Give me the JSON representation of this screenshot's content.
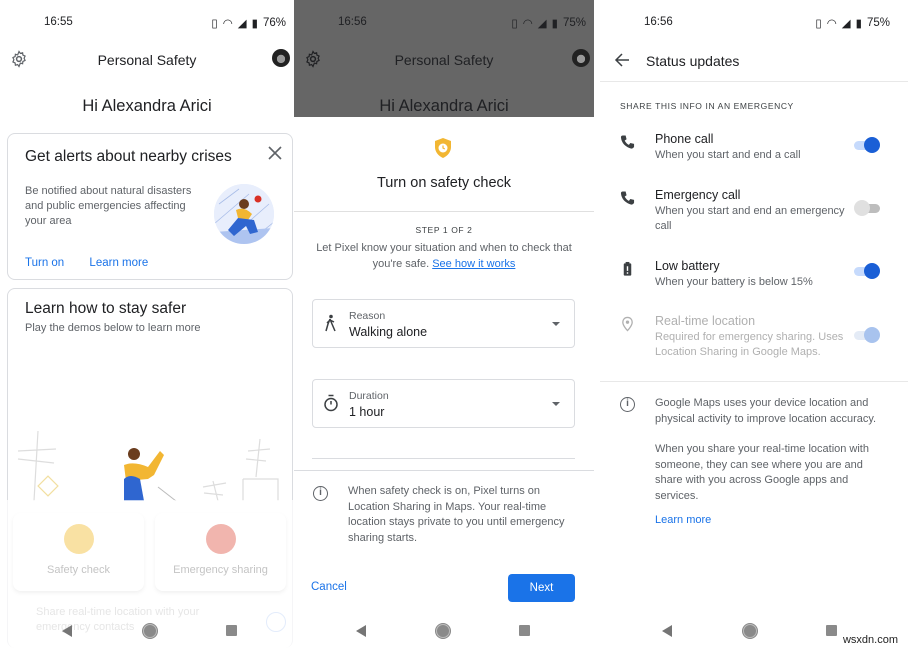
{
  "screens": [
    {
      "status": {
        "time": "16:55",
        "battery": "76%"
      },
      "appbar": {
        "title": "Personal Safety"
      },
      "greeting": "Hi Alexandra Arici",
      "alert_card": {
        "title": "Get alerts about nearby crises",
        "description": "Be notified about natural disasters and public emergencies affecting your area",
        "actions": [
          "Turn on",
          "Learn more"
        ]
      },
      "learn_card": {
        "title": "Learn how to stay safer",
        "subtitle": "Play the demos below to learn more"
      },
      "tiles": [
        {
          "label": "Safety check",
          "icon": "shield-clock-icon",
          "color": "#f5c451"
        },
        {
          "label": "Emergency sharing",
          "icon": "location-broadcast-icon",
          "color": "#e57368"
        }
      ],
      "ghost_text": "Share real-time location with your emergency contacts"
    },
    {
      "status": {
        "time": "16:56",
        "battery": "75%"
      },
      "appbar": {
        "title": "Personal Safety"
      },
      "greeting": "Hi Alexandra Arici",
      "sheet": {
        "title": "Turn on safety check",
        "step": "STEP 1 OF 2",
        "description": "Let Pixel know your situation and when to check that you're safe.",
        "link": "See how it works",
        "reason": {
          "label": "Reason",
          "value": "Walking alone"
        },
        "duration": {
          "label": "Duration",
          "value": "1 hour"
        },
        "info": "When safety check is on, Pixel turns on Location Sharing in Maps. Your real-time location stays private to you until emergency sharing starts.",
        "cancel": "Cancel",
        "next": "Next"
      }
    },
    {
      "status": {
        "time": "16:56",
        "battery": "75%"
      },
      "title": "Status updates",
      "section_header": "SHARE THIS INFO IN AN EMERGENCY",
      "rows": [
        {
          "title": "Phone call",
          "subtitle": "When you start and end a call",
          "icon": "phone-icon",
          "enabled": true,
          "disabled": false
        },
        {
          "title": "Emergency call",
          "subtitle": "When you start and end an emergency call",
          "icon": "phone-icon",
          "enabled": false,
          "disabled": false
        },
        {
          "title": "Low battery",
          "subtitle": "When your battery is below 15%",
          "icon": "battery-alert-icon",
          "enabled": true,
          "disabled": false
        },
        {
          "title": "Real-time location",
          "subtitle": "Required for emergency sharing. Uses Location Sharing in Google Maps.",
          "icon": "location-pin-icon",
          "enabled": true,
          "disabled": true
        }
      ],
      "info_paragraphs": [
        "Google Maps uses your device location and physical activity to improve location accuracy.",
        "When you share your real-time location with someone, they can see where you are and share with you across Google apps and services."
      ],
      "learn_more": "Learn more"
    }
  ],
  "watermark": "wsxdn.com",
  "colors": {
    "accent": "#1a73e8",
    "toggle_on": "#1a5fd6",
    "overlay": "#666666"
  }
}
